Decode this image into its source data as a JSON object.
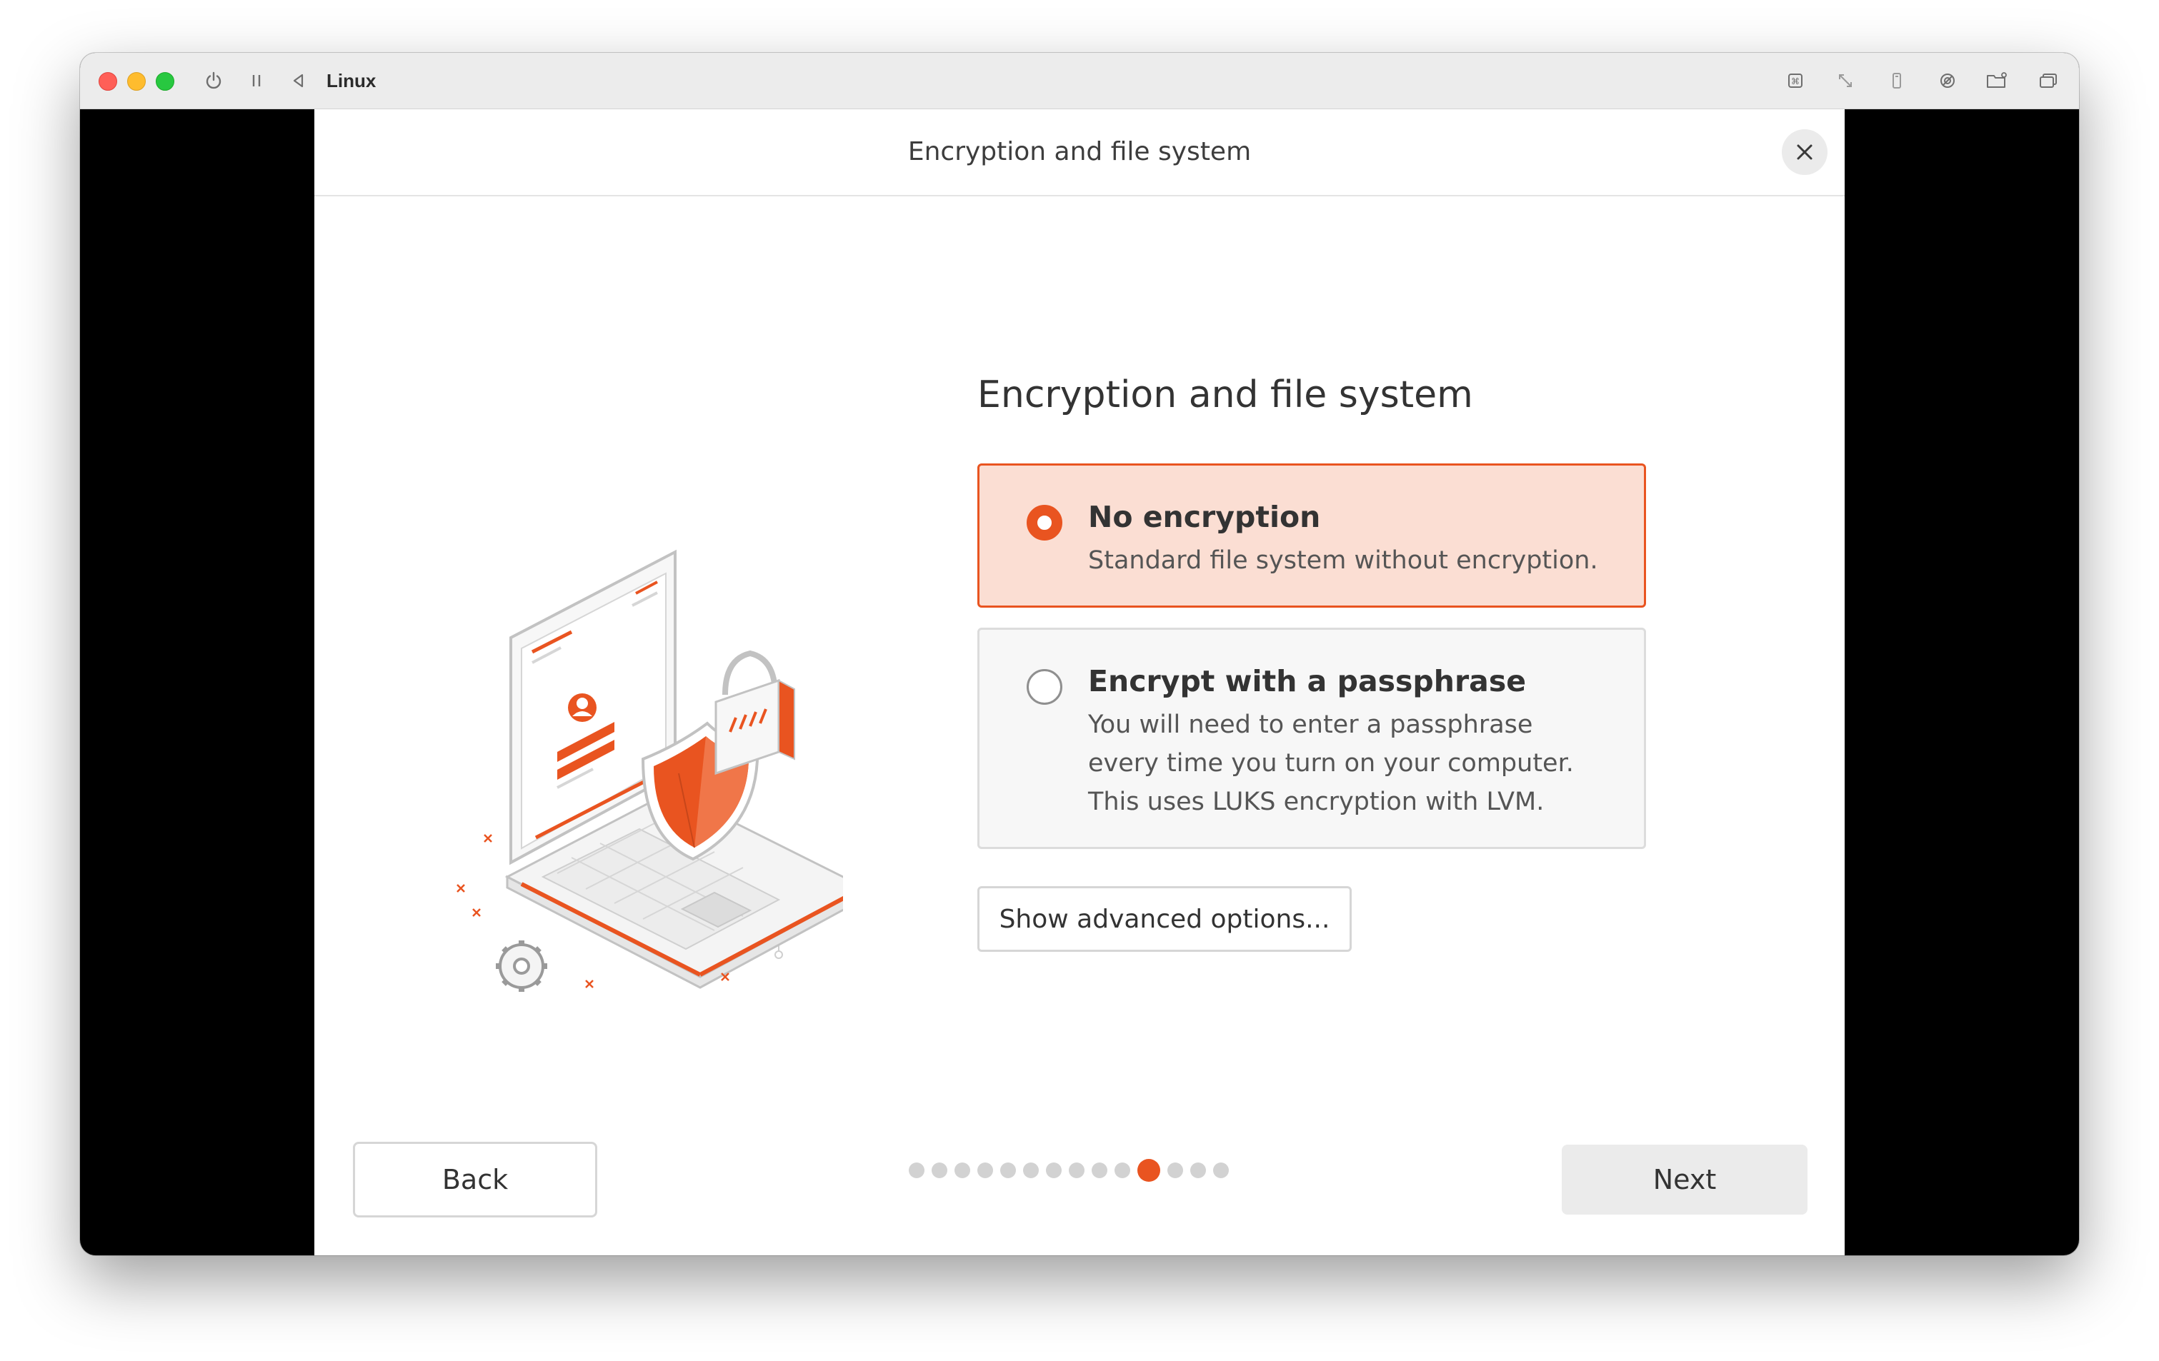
{
  "vm_window": {
    "title": "Linux",
    "toolbar_icons": [
      "power-icon",
      "pause-icon",
      "back-arrow-icon",
      "keyboard-icon",
      "resize-icon",
      "usb-icon",
      "settings-icon",
      "shared-folder-icon",
      "window-icon"
    ]
  },
  "installer": {
    "header_title": "Encryption and file system",
    "section_title": "Encryption and file system",
    "options": [
      {
        "title": "No encryption",
        "description": [
          "Standard file system without encryption."
        ],
        "selected": true
      },
      {
        "title": "Encrypt with a passphrase",
        "description": [
          "You will need to enter a passphrase",
          "every time you turn on your computer.",
          "This uses LUKS encryption with LVM."
        ],
        "selected": false
      }
    ],
    "advanced_button": "Show advanced options...",
    "back_button": "Back",
    "next_button": "Next",
    "progress": {
      "total_steps": 14,
      "current_step": 11
    }
  },
  "colors": {
    "accent": "#e95420",
    "selected_bg": "#fbded3",
    "card_bg": "#f7f7f7"
  }
}
